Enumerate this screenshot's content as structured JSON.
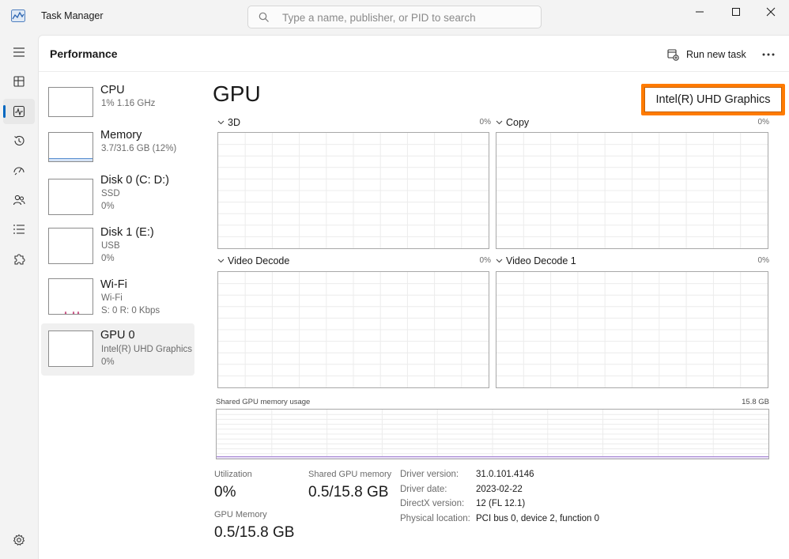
{
  "window": {
    "title": "Task Manager"
  },
  "search": {
    "placeholder": "Type a name, publisher, or PID to search"
  },
  "header": {
    "title": "Performance",
    "run_task_label": "Run new task"
  },
  "devices": [
    {
      "name": "CPU",
      "line1": "1%  1.16 GHz",
      "line2": ""
    },
    {
      "name": "Memory",
      "line1": "3.7/31.6 GB (12%)",
      "line2": ""
    },
    {
      "name": "Disk 0 (C: D:)",
      "line1": "SSD",
      "line2": "0%"
    },
    {
      "name": "Disk 1 (E:)",
      "line1": "USB",
      "line2": "0%"
    },
    {
      "name": "Wi-Fi",
      "line1": "Wi-Fi",
      "line2": "S: 0  R: 0 Kbps"
    },
    {
      "name": "GPU 0",
      "line1": "Intel(R) UHD Graphics",
      "line2": "0%"
    }
  ],
  "gpu": {
    "title": "GPU",
    "model": "Intel(R) UHD Graphics",
    "engines": [
      {
        "label": "3D",
        "percent": "0%"
      },
      {
        "label": "Copy",
        "percent": "0%"
      },
      {
        "label": "Video Decode",
        "percent": "0%"
      },
      {
        "label": "Video Decode 1",
        "percent": "0%"
      }
    ],
    "shared_memory_graph": {
      "label": "Shared GPU memory usage",
      "max": "15.8 GB"
    },
    "stats": {
      "utilization_label": "Utilization",
      "utilization_value": "0%",
      "shared_label": "Shared GPU memory",
      "shared_value": "0.5/15.8 GB",
      "gpu_memory_label": "GPU Memory",
      "gpu_memory_value": "0.5/15.8 GB"
    },
    "info": [
      {
        "key": "Driver version:",
        "value": "31.0.101.4146"
      },
      {
        "key": "Driver date:",
        "value": "2023-02-22"
      },
      {
        "key": "DirectX version:",
        "value": "12 (FL 12.1)"
      },
      {
        "key": "Physical location:",
        "value": "PCI bus 0, device 2, function 0"
      }
    ]
  },
  "colors": {
    "accent": "#0067c0",
    "highlight": "#ff7b00",
    "gpu_line": "#a98bd6",
    "memory_line": "#5a8fd0",
    "wifi_line": "#c5457a"
  }
}
